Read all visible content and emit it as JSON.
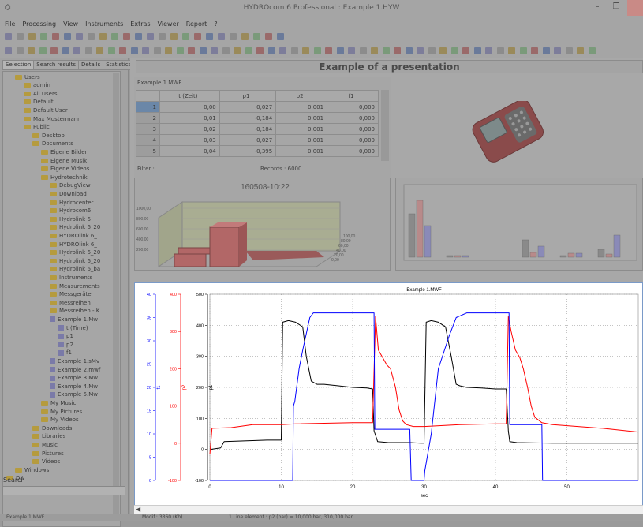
{
  "window": {
    "title": "HYDROcom 6 Professional : Example 1.HYW",
    "minimize_label": "–",
    "restore_label": "❐"
  },
  "menu": [
    "File",
    "Processing",
    "View",
    "Instruments",
    "Extras",
    "Viewer",
    "Report",
    "?"
  ],
  "left_panel": {
    "tabs": [
      "Selection",
      "Search results",
      "Details",
      "Statistics"
    ],
    "tree": [
      {
        "label": "Users",
        "depth": 1,
        "kind": "folder"
      },
      {
        "label": "admin",
        "depth": 2,
        "kind": "folder"
      },
      {
        "label": "All Users",
        "depth": 2,
        "kind": "folder"
      },
      {
        "label": "Default",
        "depth": 2,
        "kind": "folder"
      },
      {
        "label": "Default User",
        "depth": 2,
        "kind": "folder"
      },
      {
        "label": "Max Mustermann",
        "depth": 2,
        "kind": "folder"
      },
      {
        "label": "Public",
        "depth": 2,
        "kind": "folder"
      },
      {
        "label": "Desktop",
        "depth": 3,
        "kind": "folder"
      },
      {
        "label": "Documents",
        "depth": 3,
        "kind": "folder"
      },
      {
        "label": "Eigene Bilder",
        "depth": 4,
        "kind": "folder"
      },
      {
        "label": "Eigene Musik",
        "depth": 4,
        "kind": "folder"
      },
      {
        "label": "Eigene Videos",
        "depth": 4,
        "kind": "folder"
      },
      {
        "label": "Hydrotechnik",
        "depth": 4,
        "kind": "folder"
      },
      {
        "label": "DebugView",
        "depth": 5,
        "kind": "folder"
      },
      {
        "label": "Download",
        "depth": 5,
        "kind": "folder"
      },
      {
        "label": "Hydrocenter",
        "depth": 5,
        "kind": "folder"
      },
      {
        "label": "Hydrocom6",
        "depth": 5,
        "kind": "folder"
      },
      {
        "label": "Hydrolink 6",
        "depth": 5,
        "kind": "folder"
      },
      {
        "label": "Hydrolink 6_20",
        "depth": 5,
        "kind": "folder"
      },
      {
        "label": "HYDROlink 6_",
        "depth": 5,
        "kind": "folder"
      },
      {
        "label": "HYDROlink 6_",
        "depth": 5,
        "kind": "folder"
      },
      {
        "label": "Hydrolink 6_20",
        "depth": 5,
        "kind": "folder"
      },
      {
        "label": "Hydrolink 6_20",
        "depth": 5,
        "kind": "folder"
      },
      {
        "label": "Hydrolink 6_ba",
        "depth": 5,
        "kind": "folder"
      },
      {
        "label": "Instruments",
        "depth": 5,
        "kind": "folder"
      },
      {
        "label": "Measurements",
        "depth": 5,
        "kind": "folder"
      },
      {
        "label": "Messgeräte",
        "depth": 5,
        "kind": "folder"
      },
      {
        "label": "Messreihen",
        "depth": 5,
        "kind": "folder"
      },
      {
        "label": "Messreihen - K",
        "depth": 5,
        "kind": "folder"
      },
      {
        "label": "Example 1.Mw",
        "depth": 5,
        "kind": "file"
      },
      {
        "label": "t (Time)",
        "depth": 6,
        "kind": "file"
      },
      {
        "label": "p1",
        "depth": 6,
        "kind": "file"
      },
      {
        "label": "p2",
        "depth": 6,
        "kind": "file"
      },
      {
        "label": "f1",
        "depth": 6,
        "kind": "file"
      },
      {
        "label": "Example 1.sMv",
        "depth": 5,
        "kind": "file"
      },
      {
        "label": "Example 2.mwf",
        "depth": 5,
        "kind": "file"
      },
      {
        "label": "Example 3.Mw",
        "depth": 5,
        "kind": "file"
      },
      {
        "label": "Example 4.Mw",
        "depth": 5,
        "kind": "file"
      },
      {
        "label": "Example 5.Mw",
        "depth": 5,
        "kind": "file"
      },
      {
        "label": "My Music",
        "depth": 4,
        "kind": "folder"
      },
      {
        "label": "My Pictures",
        "depth": 4,
        "kind": "folder"
      },
      {
        "label": "My Videos",
        "depth": 4,
        "kind": "folder"
      },
      {
        "label": "Downloads",
        "depth": 3,
        "kind": "folder"
      },
      {
        "label": "Libraries",
        "depth": 3,
        "kind": "folder"
      },
      {
        "label": "Music",
        "depth": 3,
        "kind": "folder"
      },
      {
        "label": "Pictures",
        "depth": 3,
        "kind": "folder"
      },
      {
        "label": "Videos",
        "depth": 3,
        "kind": "folder"
      },
      {
        "label": "Windows",
        "depth": 1,
        "kind": "folder"
      },
      {
        "label": "D:\\",
        "depth": 0,
        "kind": "folder"
      }
    ],
    "search_label": "Search"
  },
  "presentation": {
    "title": "Example of a presentation",
    "table_title": "Example 1.MWF",
    "columns": [
      "",
      "t (Zeit)",
      "p1",
      "p2",
      "f1"
    ],
    "rows": [
      [
        "1",
        "0,00",
        "0,027",
        "0,001",
        "0,000"
      ],
      [
        "2",
        "0,01",
        "-0,184",
        "0,001",
        "0,000"
      ],
      [
        "3",
        "0,02",
        "-0,184",
        "0,001",
        "0,000"
      ],
      [
        "4",
        "0,03",
        "0,027",
        "0,001",
        "0,000"
      ],
      [
        "5",
        "0,04",
        "-0,395",
        "0,001",
        "0,000"
      ]
    ],
    "filter_label": "Filter :",
    "records_label": "Records : 6000",
    "chart3d_title": "160508-10:22",
    "chart3d_yticks": [
      "1000,00",
      "800,00",
      "600,00",
      "400,00",
      "200,00"
    ],
    "chart3d_zticks": [
      "100,00",
      "80,00",
      "60,00",
      "40,00",
      "20,00",
      "0,00"
    ]
  },
  "status": {
    "left": "Example 1.MWF",
    "mid": "Modif.: 3360 (Kb)",
    "right": "1 Line element : p2 (bar) = 10,000 bar, 310,000 bar"
  },
  "colors": {
    "f1": "#0000ff",
    "p2": "#ff0000",
    "p1": "#000000",
    "grid": "#888888"
  },
  "chart_data": {
    "type": "line",
    "title": "Example 1.MWF",
    "xlabel": "sec",
    "xlim": [
      0,
      60
    ],
    "x_ticks": [
      0,
      10,
      20,
      30,
      40,
      50
    ],
    "axes": [
      {
        "label": "f1",
        "color": "#0000ff",
        "ylim": [
          0,
          40
        ],
        "ticks": [
          0,
          5,
          10,
          15,
          20,
          25,
          30,
          35,
          40
        ]
      },
      {
        "label": "p2",
        "color": "#ff0000",
        "ylim": [
          -100,
          400
        ],
        "ticks": [
          -100,
          0,
          100,
          200,
          300,
          400
        ]
      },
      {
        "label": "p1",
        "color": "#000000",
        "ylim": [
          -100,
          500
        ],
        "ticks": [
          -100,
          0,
          100,
          200,
          300,
          400,
          500
        ]
      }
    ],
    "series": [
      {
        "name": "p1",
        "axis": "p1",
        "color": "#000000",
        "x": [
          0,
          1.5,
          2,
          8,
          10,
          10.2,
          11,
          12,
          13,
          13.5,
          14.2,
          15,
          16,
          18,
          20,
          22,
          22.8,
          23,
          23.5,
          25,
          28,
          29.5,
          30,
          30.3,
          31,
          32,
          33,
          33.8,
          34.5,
          35,
          36,
          38,
          40,
          41.5,
          41.8,
          42,
          43,
          48,
          55,
          61
        ],
        "values": [
          0,
          5,
          25,
          30,
          30,
          410,
          415,
          410,
          395,
          300,
          220,
          210,
          210,
          205,
          200,
          198,
          195,
          60,
          25,
          22,
          22,
          20,
          20,
          410,
          415,
          410,
          395,
          300,
          210,
          205,
          200,
          198,
          195,
          195,
          60,
          25,
          22,
          20,
          20,
          20
        ]
      },
      {
        "name": "p2",
        "axis": "p2",
        "color": "#ff0000",
        "x": [
          0,
          0.3,
          3,
          6,
          10,
          12,
          20,
          22.8,
          23.2,
          23.6,
          24.2,
          24.8,
          25.3,
          26,
          26.5,
          27,
          27.5,
          28.5,
          30,
          35,
          40,
          41.5,
          41.8,
          42.2,
          42.8,
          43.4,
          43.9,
          44.5,
          45,
          45.5,
          46.5,
          48,
          55,
          61
        ],
        "values": [
          -30,
          40,
          42,
          50,
          50,
          52,
          55,
          55,
          340,
          250,
          230,
          210,
          200,
          150,
          90,
          60,
          50,
          45,
          45,
          50,
          52,
          52,
          340,
          300,
          250,
          230,
          200,
          150,
          100,
          70,
          55,
          50,
          40,
          30
        ]
      },
      {
        "name": "f1",
        "axis": "f1",
        "color": "#0000ff",
        "x": [
          0,
          11.6,
          11.7,
          11.9,
          12.5,
          13,
          14,
          14.5,
          16,
          20,
          23,
          23.1,
          25,
          28,
          28.2,
          28.3,
          30,
          30.1,
          31,
          32,
          33.5,
          34.5,
          36,
          40,
          41.9,
          42,
          46.5,
          46.6,
          61
        ],
        "values": [
          0,
          0,
          16,
          17,
          24,
          28,
          35,
          36,
          36,
          36,
          36,
          11,
          11,
          11,
          0,
          0,
          0,
          2,
          10,
          24,
          31,
          35,
          36,
          36,
          36,
          12,
          12,
          0,
          0
        ]
      }
    ]
  }
}
